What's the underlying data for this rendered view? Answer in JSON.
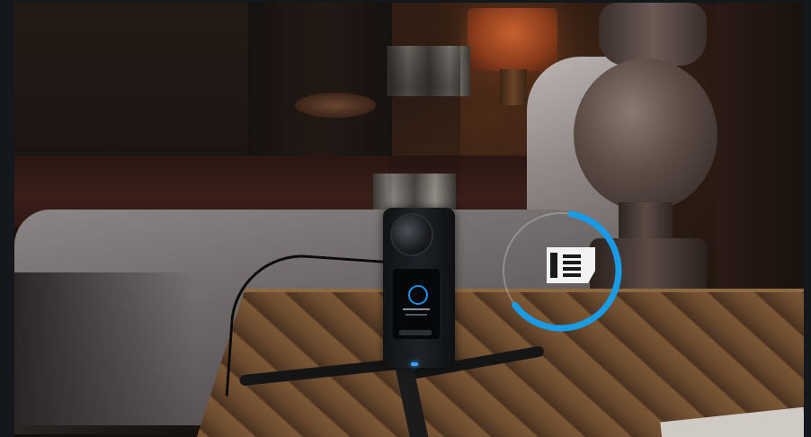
{
  "scene": {
    "description_visible": "",
    "accent_color": "#1a9be6"
  },
  "camera_screen": {
    "indicator": "",
    "status_text": "",
    "button_text": ""
  },
  "overlay": {
    "icon": "sd-card-icon",
    "progress_fraction": 0.62,
    "ring_color": "#1a9be6"
  }
}
